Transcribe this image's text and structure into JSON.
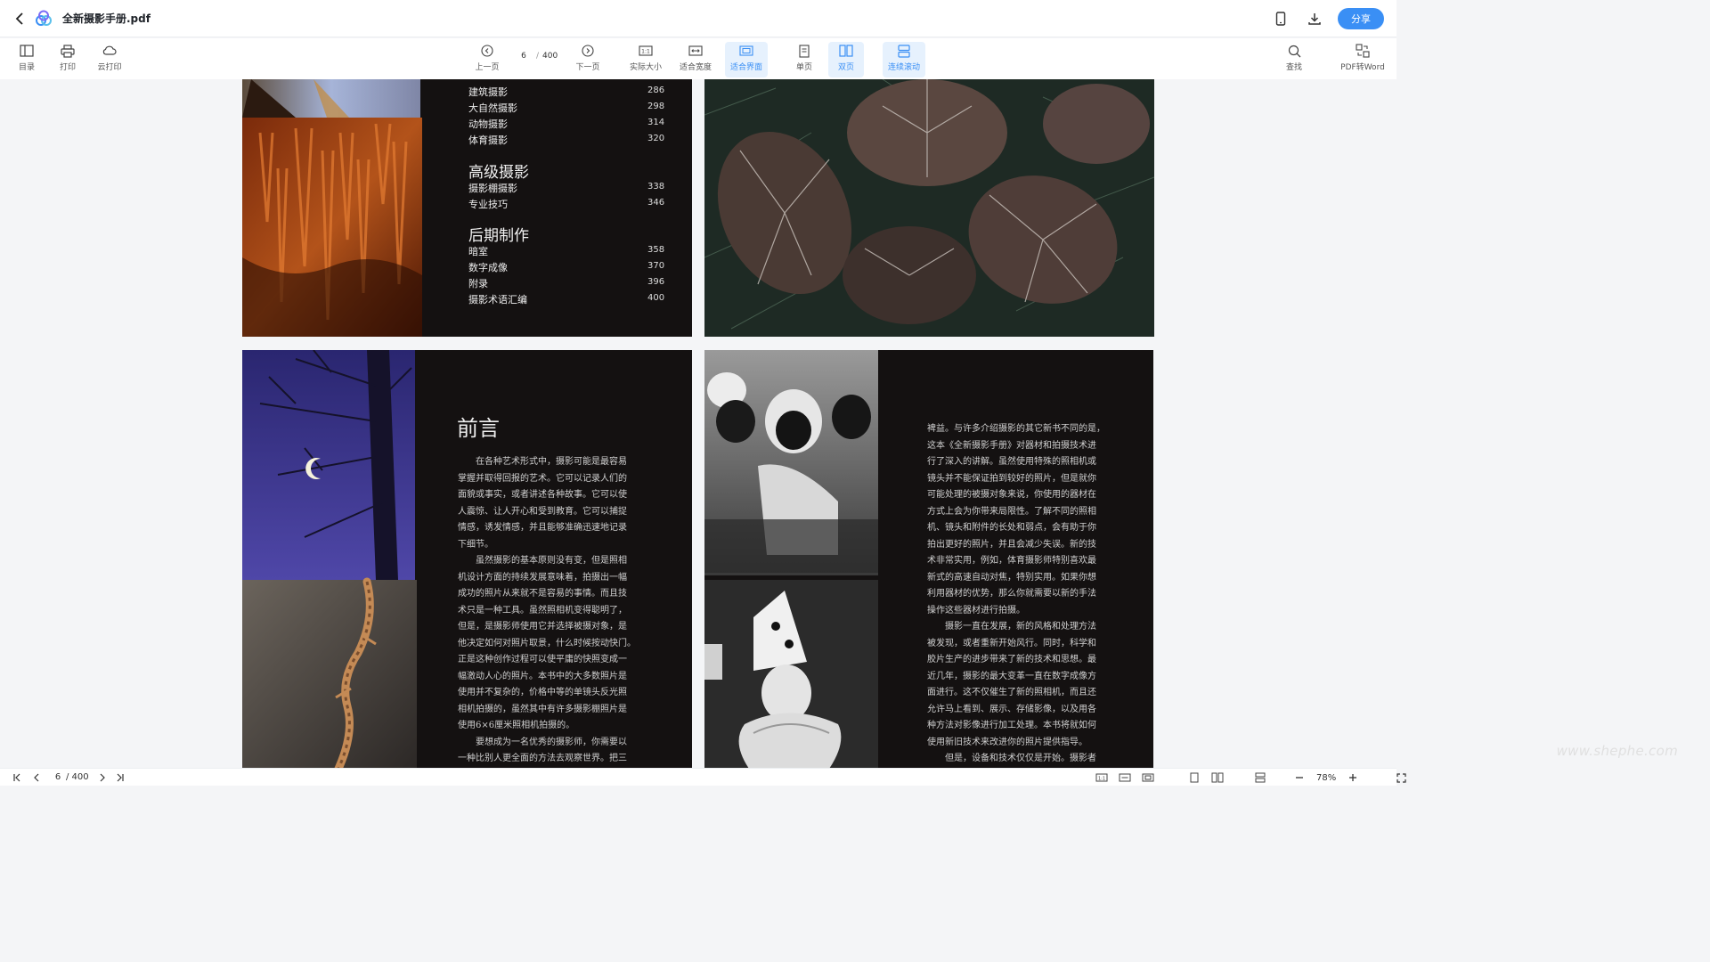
{
  "app": {
    "title": "全新摄影手册.pdf",
    "share_label": "分享"
  },
  "toolbar": {
    "toc_label": "目录",
    "print_label": "打印",
    "cloud_print_label": "云打印",
    "prev_label": "上一页",
    "next_label": "下一页",
    "current_page": "6",
    "total_pages": "400",
    "actual_size_label": "实际大小",
    "fit_width_label": "适合宽度",
    "fit_page_label": "适合界面",
    "single_label": "单页",
    "double_label": "双页",
    "scroll_label": "连续滚动",
    "find_label": "查找",
    "to_word_label": "PDF转Word"
  },
  "toc": {
    "rows": [
      {
        "label": "建筑摄影",
        "page": "286"
      },
      {
        "label": "大自然摄影",
        "page": "298"
      },
      {
        "label": "动物摄影",
        "page": "314"
      },
      {
        "label": "体育摄影",
        "page": "320"
      }
    ],
    "section2": "高级摄影",
    "rows2": [
      {
        "label": "摄影棚摄影",
        "page": "338"
      },
      {
        "label": "专业技巧",
        "page": "346"
      }
    ],
    "section3": "后期制作",
    "rows3": [
      {
        "label": "暗室",
        "page": "358"
      },
      {
        "label": "数字成像",
        "page": "370"
      },
      {
        "label": "附录",
        "page": "396"
      },
      {
        "label": "摄影术语汇编",
        "page": "400"
      }
    ]
  },
  "preface": {
    "title": "前言",
    "left_lines": [
      "　　在各种艺术形式中，摄影可能是最容易",
      "掌握并取得回报的艺术。它可以记录人们的",
      "面貌或事实，或者讲述各种故事。它可以使",
      "人震惊、让人开心和受到教育。它可以捕捉",
      "情感，诱发情感，并且能够准确迅速地记录",
      "下细节。",
      "　　虽然摄影的基本原则没有变，但是照相",
      "机设计方面的持续发展意味着，拍摄出一幅",
      "成功的照片从来就不是容易的事情。而且技",
      "术只是一种工具。虽然照相机变得聪明了，",
      "但是，是摄影师使用它并选择被摄对象，是",
      "他决定如何对照片取景，什么时候按动快门。",
      "正是这种创作过程可以使平庸的快照变成一",
      "幅激动人心的照片。本书中的大多数照片是",
      "使用并不复杂的，价格中等的单镜头反光照",
      "相机拍摄的，虽然其中有许多摄影棚照片是",
      "使用6×6厘米照相机拍摄的。",
      "　　要想成为一名优秀的摄影师，你需要以",
      "一种比别人更全面的方法去观察世界。把三"
    ],
    "right_lines": [
      "裨益。与许多介绍摄影的其它新书不同的是，",
      "这本《全新摄影手册》对器材和拍摄技术进",
      "行了深入的讲解。虽然使用特殊的照相机或",
      "镜头并不能保证拍到较好的照片，但是就你",
      "可能处理的被摄对象来说，你使用的器材在",
      "方式上会为你带来局限性。了解不同的照相",
      "机、镜头和附件的长处和弱点，会有助于你",
      "拍出更好的照片，并且会减少失误。新的技",
      "术非常实用，例如，体育摄影师特别喜欢最",
      "新式的高速自动对焦，特别实用。如果你想",
      "利用器材的优势，那么你就需要以新的手法",
      "操作这些器材进行拍摄。",
      "　　摄影一直在发展，新的风格和处理方法",
      "被发现，或者重新开始风行。同时，科学和",
      "胶片生产的进步带来了新的技术和思想。最",
      "近几年，摄影的最大变革一直在数字成像方",
      "面进行。这不仅催生了新的照相机，而且还",
      "允许马上看到、展示、存储影像，以及用各",
      "种方法对影像进行加工处理。本书将就如何",
      "使用新旧技术来改进你的照片提供指导。",
      "　　但是，设备和技术仅仅是开始。摄影者"
    ]
  },
  "statusbar": {
    "current_page": "6",
    "total_pages": "/ 400",
    "zoom": "78%"
  },
  "watermark": "www.shephe.com",
  "colors": {
    "accent": "#3a8ff5",
    "page_bg": "#141111"
  }
}
